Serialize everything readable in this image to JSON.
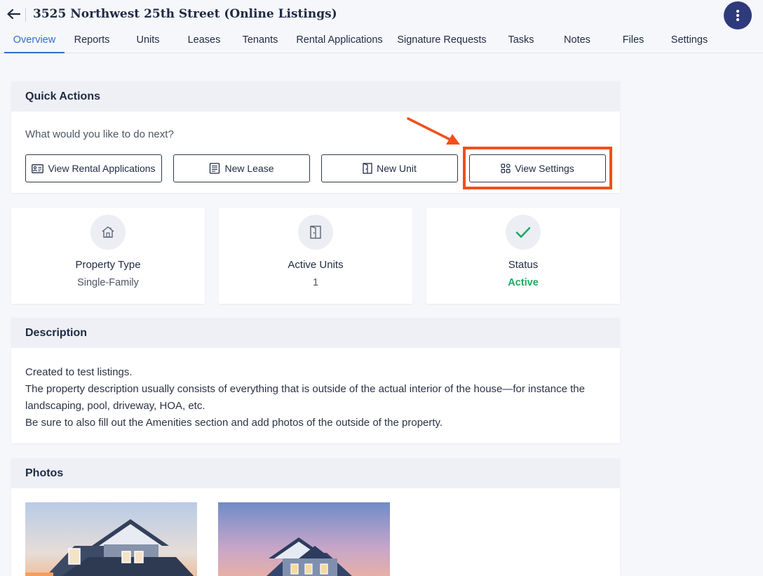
{
  "header": {
    "title": "3525 Northwest 25th Street (Online Listings)"
  },
  "tabs": [
    {
      "label": "Overview",
      "active": true
    },
    {
      "label": "Reports"
    },
    {
      "label": "Units"
    },
    {
      "label": "Leases"
    },
    {
      "label": "Tenants"
    },
    {
      "label": "Rental Applications"
    },
    {
      "label": "Signature Requests"
    },
    {
      "label": "Tasks"
    },
    {
      "label": "Notes"
    },
    {
      "label": "Files"
    },
    {
      "label": "Settings"
    }
  ],
  "quick_actions": {
    "title": "Quick Actions",
    "prompt": "What would you like to do next?",
    "buttons": [
      {
        "label": "View Rental Applications",
        "icon": "id-card-icon"
      },
      {
        "label": "New Lease",
        "icon": "document-icon"
      },
      {
        "label": "New Unit",
        "icon": "door-icon"
      },
      {
        "label": "View Settings",
        "icon": "grid-icon"
      }
    ]
  },
  "stats": [
    {
      "label": "Property Type",
      "value": "Single-Family",
      "icon": "house-icon"
    },
    {
      "label": "Active Units",
      "value": "1",
      "icon": "door-icon"
    },
    {
      "label": "Status",
      "value": "Active",
      "icon": "checkmark-icon",
      "color": "#1aab5f"
    }
  ],
  "description": {
    "title": "Description",
    "lines": [
      "Created to test listings.",
      "The property description usually consists of everything that is outside of the actual interior of the house—for instance the landscaping, pool, driveway, HOA, etc.",
      "Be sure to also fill out the Amenities section and add photos of the outside of the property."
    ]
  },
  "photos": {
    "title": "Photos"
  },
  "colors": {
    "accent": "#2f6fcb",
    "brand": "#2e3a7c",
    "highlight": "#f1501d",
    "success": "#1aab5f"
  }
}
